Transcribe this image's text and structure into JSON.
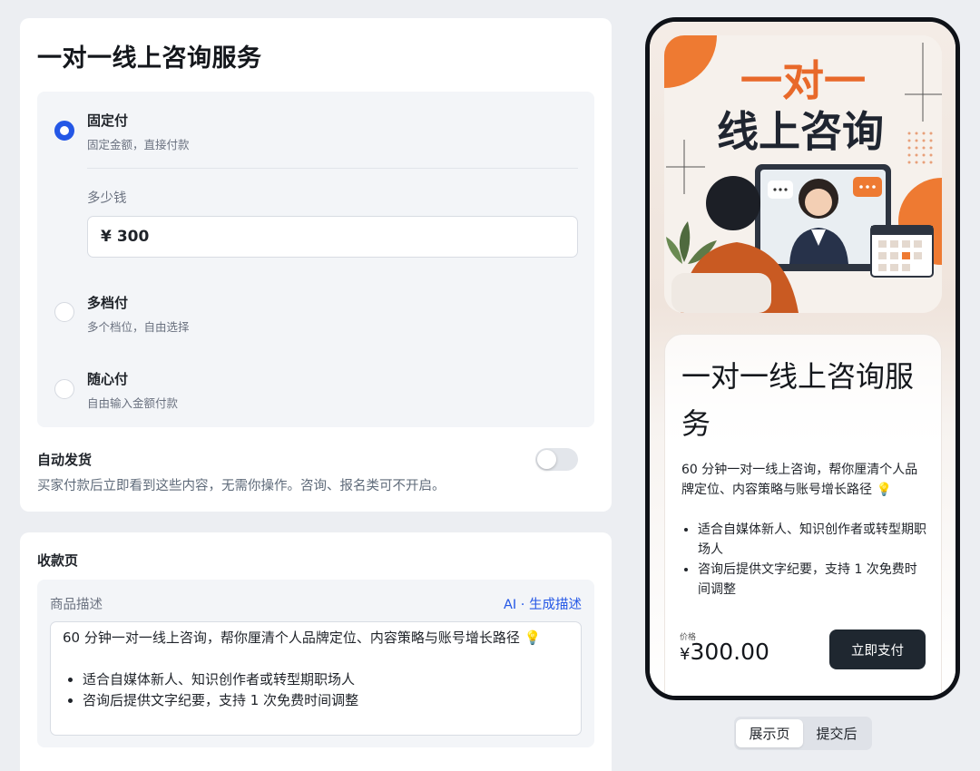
{
  "card_main": {
    "title": "一对一线上咨询服务",
    "payment_options": [
      {
        "title": "固定付",
        "desc": "固定金额，直接付款",
        "selected": true
      },
      {
        "title": "多档付",
        "desc": "多个档位，自由选择",
        "selected": false
      },
      {
        "title": "随心付",
        "desc": "自由输入金额付款",
        "selected": false
      }
    ],
    "amount": {
      "label": "多少钱",
      "currency": "¥",
      "value": "300"
    },
    "auto_ship": {
      "title": "自动发货",
      "desc": "买家付款后立即看到这些内容，无需你操作。咨询、报名类可不开启。",
      "enabled": false
    }
  },
  "card_page": {
    "title": "收款页",
    "desc_label": "商品描述",
    "ai_link": "AI · 生成描述",
    "desc_text": "60 分钟一对一线上咨询，帮你厘清个人品牌定位、内容策略与账号增长路径 💡",
    "desc_bullets": [
      "适合自媒体新人、知识创作者或转型期职场人",
      "咨询后提供文字纪要，支持 1 次免费时间调整"
    ]
  },
  "preview": {
    "poster": {
      "line1": "一对一",
      "line2": "线上咨询"
    },
    "title": "一对一线上咨询服务",
    "desc": "60 分钟一对一线上咨询，帮你厘清个人品牌定位、内容策略与账号增长路径 💡",
    "bullets": [
      "适合自媒体新人、知识创作者或转型期职场人",
      "咨询后提供文字纪要，支持 1 次免费时间调整"
    ],
    "price_label": "价格",
    "price_currency": "¥",
    "price_value": "300.00",
    "pay_button": "立即支付"
  },
  "tabs": {
    "display": "展示页",
    "after_submit": "提交后",
    "active": "展示页"
  },
  "colors": {
    "accent": "#2457e6",
    "poster_orange": "#e8692a",
    "dark_button": "#1f2730"
  }
}
